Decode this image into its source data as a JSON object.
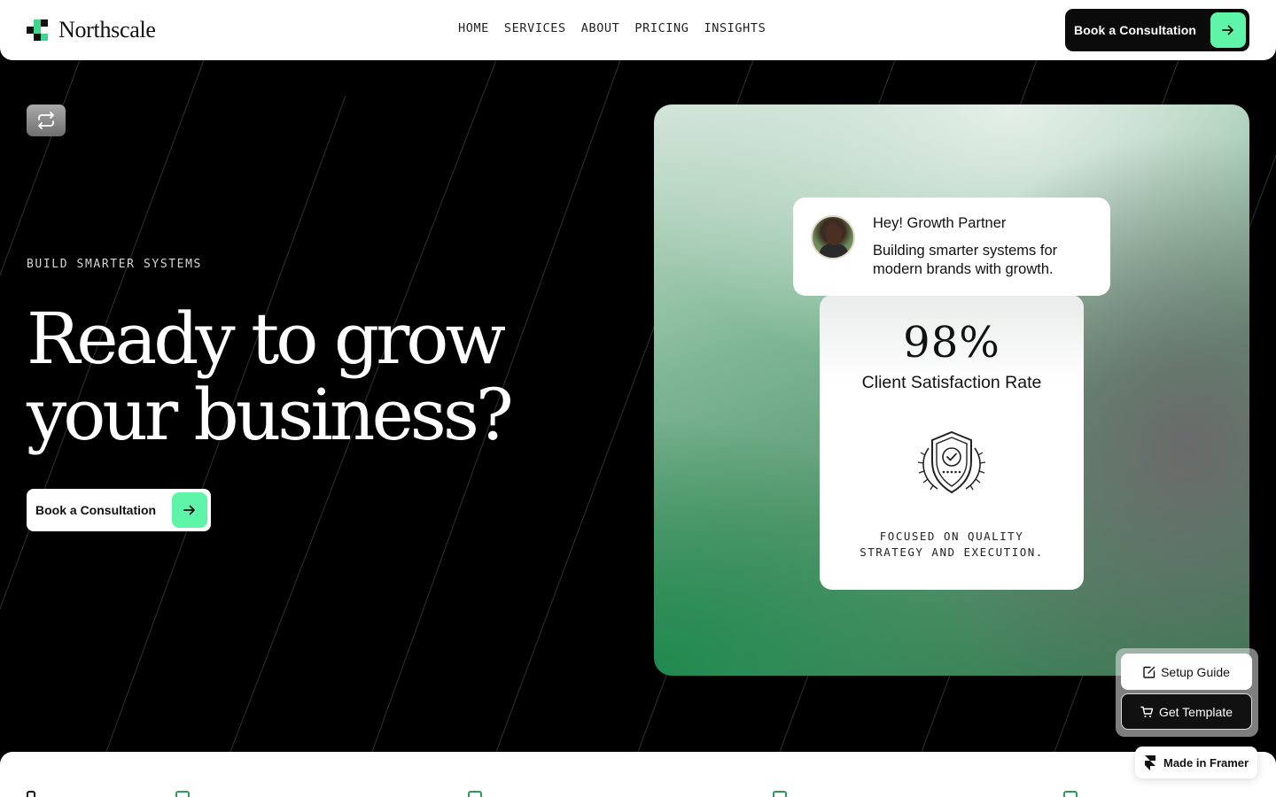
{
  "brand": {
    "name": "Northscale"
  },
  "nav": {
    "links": [
      "HOME",
      "SERVICES",
      "ABOUT",
      "PRICING",
      "INSIGHTS"
    ],
    "cta_label": "Book a Consultation"
  },
  "hero": {
    "eyebrow": "BUILD SMARTER SYSTEMS",
    "headline_line1": "Ready to grow",
    "headline_line2": "your business?",
    "cta_label": "Book a Consultation"
  },
  "chat": {
    "title": "Hey! Growth Partner",
    "message": "Building smarter systems for modern brands with growth."
  },
  "stat": {
    "value": "98%",
    "label": "Client Satisfaction Rate",
    "caption_line1": "FOCUSED ON QUALITY",
    "caption_line2": "STRATEGY AND EXECUTION."
  },
  "template_panel": {
    "setup_label": "Setup Guide",
    "get_label": "Get Template"
  },
  "badge": {
    "label": "Made in Framer"
  },
  "colors": {
    "accent": "#5ef5a8",
    "dark": "#0b0b0b",
    "green": "#1f8a4e"
  },
  "icons": [
    "arrow-right-icon",
    "loop-icon",
    "shield-badge-icon",
    "edit-icon",
    "cart-icon",
    "framer-icon"
  ]
}
